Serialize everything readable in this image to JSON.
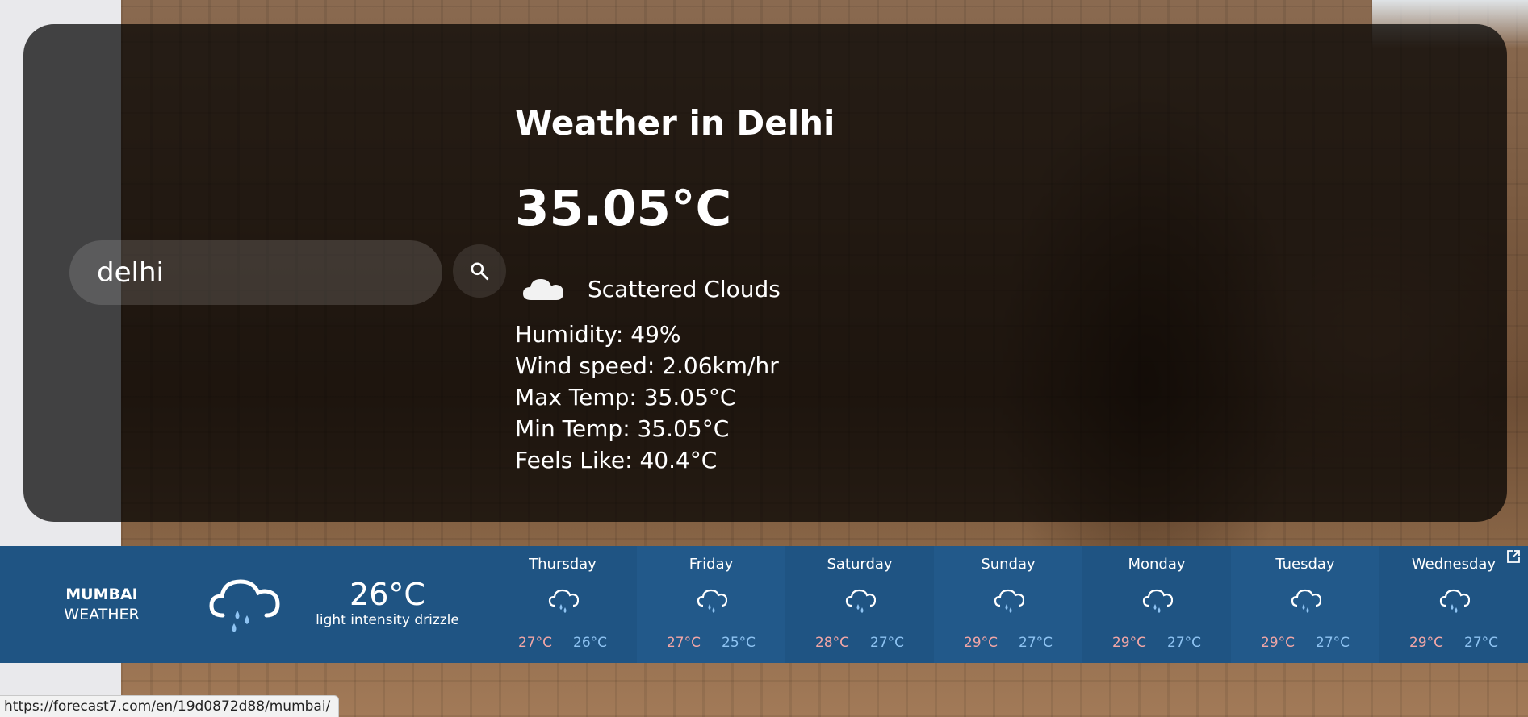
{
  "search": {
    "value": "delhi"
  },
  "weather": {
    "title": "Weather in Delhi",
    "temp": "35.05°C",
    "description": "Scattered Clouds",
    "icon": "cloud-icon",
    "details": [
      "Humidity: 49%",
      "Wind speed: 2.06km/hr",
      "Max Temp: 35.05°C",
      "Min Temp: 35.05°C",
      "Feels Like: 40.4°C"
    ]
  },
  "widget": {
    "city": "MUMBAI",
    "subtitle": "WEATHER",
    "current_temp": "26°C",
    "current_desc": "light intensity drizzle",
    "icon": "rain-cloud-icon",
    "days": [
      {
        "name": "Thursday",
        "hi": "27°C",
        "lo": "26°C"
      },
      {
        "name": "Friday",
        "hi": "27°C",
        "lo": "25°C"
      },
      {
        "name": "Saturday",
        "hi": "28°C",
        "lo": "27°C"
      },
      {
        "name": "Sunday",
        "hi": "29°C",
        "lo": "27°C"
      },
      {
        "name": "Monday",
        "hi": "29°C",
        "lo": "27°C"
      },
      {
        "name": "Tuesday",
        "hi": "29°C",
        "lo": "27°C"
      },
      {
        "name": "Wednesday",
        "hi": "29°C",
        "lo": "27°C"
      }
    ],
    "colors": {
      "background": "#1f5483",
      "hi": "#f2a6a6",
      "lo": "#8ec3f2"
    }
  },
  "status_url": "https://forecast7.com/en/19d0872d88/mumbai/"
}
